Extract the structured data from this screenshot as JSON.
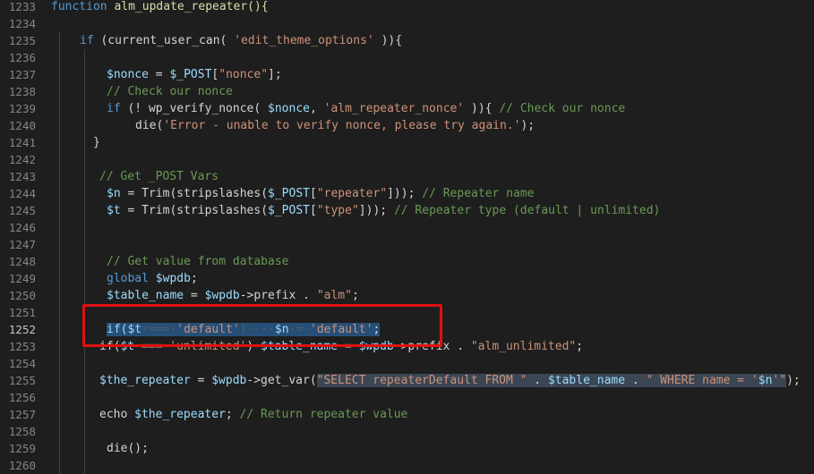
{
  "editor": {
    "active_line": "1252",
    "lines": [
      {
        "n": "1233",
        "indent": 0,
        "tokens": [
          {
            "t": "function",
            "c": "kw"
          },
          {
            "t": " alm_update_repeater(){",
            "c": "fn"
          }
        ]
      },
      {
        "n": "1234",
        "indent": 0,
        "tokens": []
      },
      {
        "n": "1235",
        "indent": 32,
        "tokens": [
          {
            "t": "if",
            "c": "kw"
          },
          {
            "t": " (current_user_can( ",
            "c": "op"
          },
          {
            "t": "'edit_theme_options'",
            "c": "str"
          },
          {
            "t": " )){",
            "c": "op"
          }
        ]
      },
      {
        "n": "1236",
        "indent": 0,
        "tokens": []
      },
      {
        "n": "1237",
        "indent": 62,
        "tokens": [
          {
            "t": "$nonce",
            "c": "var"
          },
          {
            "t": " = ",
            "c": "op"
          },
          {
            "t": "$_POST",
            "c": "var"
          },
          {
            "t": "[",
            "c": "op"
          },
          {
            "t": "\"nonce\"",
            "c": "str"
          },
          {
            "t": "];",
            "c": "op"
          }
        ]
      },
      {
        "n": "1238",
        "indent": 62,
        "tokens": [
          {
            "t": "// Check our nonce",
            "c": "cm"
          }
        ]
      },
      {
        "n": "1239",
        "indent": 62,
        "tokens": [
          {
            "t": "if",
            "c": "kw"
          },
          {
            "t": " (! wp_verify_nonce( ",
            "c": "op"
          },
          {
            "t": "$nonce",
            "c": "var"
          },
          {
            "t": ", ",
            "c": "op"
          },
          {
            "t": "'alm_repeater_nonce'",
            "c": "str"
          },
          {
            "t": " )){ ",
            "c": "op"
          },
          {
            "t": "// Check our nonce",
            "c": "cm"
          }
        ]
      },
      {
        "n": "1240",
        "indent": 94,
        "tokens": [
          {
            "t": "die(",
            "c": "op"
          },
          {
            "t": "'Error - unable to verify nonce, please try again.'",
            "c": "str"
          },
          {
            "t": ");",
            "c": "op"
          }
        ]
      },
      {
        "n": "1241",
        "indent": 47,
        "tokens": [
          {
            "t": "}",
            "c": "op"
          }
        ]
      },
      {
        "n": "1242",
        "indent": 0,
        "tokens": []
      },
      {
        "n": "1243",
        "indent": 54,
        "tokens": [
          {
            "t": "// Get _POST Vars",
            "c": "cm"
          }
        ]
      },
      {
        "n": "1244",
        "indent": 62,
        "tokens": [
          {
            "t": "$n",
            "c": "var"
          },
          {
            "t": " = Trim(stripslashes(",
            "c": "op"
          },
          {
            "t": "$_POST",
            "c": "var"
          },
          {
            "t": "[",
            "c": "op"
          },
          {
            "t": "\"repeater\"",
            "c": "str"
          },
          {
            "t": "])); ",
            "c": "op"
          },
          {
            "t": "// Repeater name",
            "c": "cm"
          }
        ]
      },
      {
        "n": "1245",
        "indent": 62,
        "tokens": [
          {
            "t": "$t",
            "c": "var"
          },
          {
            "t": " = Trim(stripslashes(",
            "c": "op"
          },
          {
            "t": "$_POST",
            "c": "var"
          },
          {
            "t": "[",
            "c": "op"
          },
          {
            "t": "\"type\"",
            "c": "str"
          },
          {
            "t": "])); ",
            "c": "op"
          },
          {
            "t": "// Repeater type (default | unlimited)",
            "c": "cm"
          }
        ]
      },
      {
        "n": "1246",
        "indent": 0,
        "tokens": []
      },
      {
        "n": "1247",
        "indent": 0,
        "tokens": []
      },
      {
        "n": "1248",
        "indent": 62,
        "tokens": [
          {
            "t": "// Get value from database",
            "c": "cm"
          }
        ]
      },
      {
        "n": "1249",
        "indent": 62,
        "tokens": [
          {
            "t": "global",
            "c": "kw"
          },
          {
            "t": " ",
            "c": "op"
          },
          {
            "t": "$wpdb",
            "c": "var"
          },
          {
            "t": ";",
            "c": "op"
          }
        ]
      },
      {
        "n": "1250",
        "indent": 62,
        "tokens": [
          {
            "t": "$table_name",
            "c": "var"
          },
          {
            "t": " = ",
            "c": "op"
          },
          {
            "t": "$wpdb",
            "c": "var"
          },
          {
            "t": "->prefix . ",
            "c": "op"
          },
          {
            "t": "\"alm\"",
            "c": "str"
          },
          {
            "t": ";",
            "c": "op"
          }
        ]
      },
      {
        "n": "1251",
        "indent": 0,
        "tokens": []
      },
      {
        "n": "1252",
        "indent": 62,
        "tokens": [
          {
            "t": "if($t",
            "c": "var",
            "h": "sel"
          },
          {
            "t": "·===·",
            "c": "ws",
            "h": "sel"
          },
          {
            "t": "'default'",
            "c": "str",
            "h": "sel"
          },
          {
            "t": ")····",
            "c": "ws",
            "h": "sel"
          },
          {
            "t": "$n",
            "c": "var",
            "h": "sel"
          },
          {
            "t": "·=·",
            "c": "ws",
            "h": "sel"
          },
          {
            "t": "'default'",
            "c": "str",
            "h": "sel"
          },
          {
            "t": ";",
            "c": "op",
            "h": "sel"
          }
        ]
      },
      {
        "n": "1253",
        "indent": 54,
        "tokens": [
          {
            "t": "if(",
            "c": "op"
          },
          {
            "t": "$t",
            "c": "var"
          },
          {
            "t": " === ",
            "c": "op"
          },
          {
            "t": "'unlimited'",
            "c": "str"
          },
          {
            "t": ") ",
            "c": "op"
          },
          {
            "t": "$table_name",
            "c": "var"
          },
          {
            "t": " = ",
            "c": "op"
          },
          {
            "t": "$wpdb",
            "c": "var"
          },
          {
            "t": "->prefix . ",
            "c": "op"
          },
          {
            "t": "\"alm_unlimited\"",
            "c": "str"
          },
          {
            "t": ";",
            "c": "op"
          }
        ]
      },
      {
        "n": "1254",
        "indent": 0,
        "tokens": []
      },
      {
        "n": "1255",
        "indent": 54,
        "tokens": [
          {
            "t": "$the_repeater",
            "c": "var"
          },
          {
            "t": " = ",
            "c": "op"
          },
          {
            "t": "$wpdb",
            "c": "var"
          },
          {
            "t": "->get_var(",
            "c": "op"
          },
          {
            "t": "\"SELECT repeaterDefault FROM \"",
            "c": "str",
            "h": "strsel"
          },
          {
            "t": " . ",
            "c": "op",
            "h": "strsel"
          },
          {
            "t": "$table_name",
            "c": "var",
            "h": "strsel"
          },
          {
            "t": " . ",
            "c": "op",
            "h": "strsel"
          },
          {
            "t": "\" WHERE name = '",
            "c": "str",
            "h": "strsel"
          },
          {
            "t": "$n",
            "c": "var",
            "h": "strsel"
          },
          {
            "t": "'\"",
            "c": "str",
            "h": "strsel"
          },
          {
            "t": ");",
            "c": "op"
          }
        ]
      },
      {
        "n": "1256",
        "indent": 0,
        "tokens": []
      },
      {
        "n": "1257",
        "indent": 54,
        "tokens": [
          {
            "t": "echo",
            "c": "op"
          },
          {
            "t": " ",
            "c": "op"
          },
          {
            "t": "$the_repeater",
            "c": "var"
          },
          {
            "t": "; ",
            "c": "op"
          },
          {
            "t": "// Return repeater value",
            "c": "cm"
          }
        ]
      },
      {
        "n": "1258",
        "indent": 0,
        "tokens": []
      },
      {
        "n": "1259",
        "indent": 62,
        "tokens": [
          {
            "t": "die();",
            "c": "op"
          }
        ]
      },
      {
        "n": "1260",
        "indent": 0,
        "tokens": []
      }
    ]
  }
}
